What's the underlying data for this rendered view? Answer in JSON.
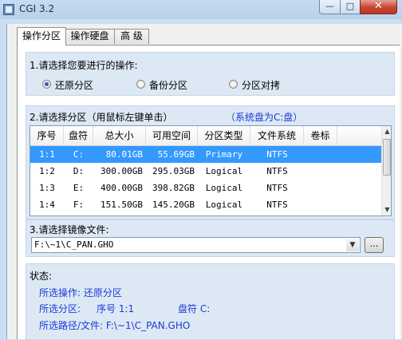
{
  "window": {
    "title": "CGI 3.2"
  },
  "tabs": [
    "操作分区",
    "操作硬盘",
    "高 级"
  ],
  "operation": {
    "label": "1.请选择您要进行的操作:",
    "options": [
      "还原分区",
      "备份分区",
      "分区对拷"
    ],
    "selected": "还原分区"
  },
  "partitions": {
    "label": "2.请选择分区（用鼠标左键单击）",
    "system_note": "（系统盘为C:盘）",
    "columns": [
      "序号",
      "盘符",
      "总大小",
      "可用空间",
      "分区类型",
      "文件系统",
      "卷标"
    ],
    "rows": [
      [
        "1:1",
        "C:",
        "80.01GB",
        "55.69GB",
        "Primary",
        "NTFS",
        ""
      ],
      [
        "1:2",
        "D:",
        "300.00GB",
        "295.03GB",
        "Logical",
        "NTFS",
        ""
      ],
      [
        "1:3",
        "E:",
        "400.00GB",
        "398.82GB",
        "Logical",
        "NTFS",
        ""
      ],
      [
        "1:4",
        "F:",
        "151.50GB",
        "145.20GB",
        "Logical",
        "NTFS",
        ""
      ]
    ],
    "selected_row": 0
  },
  "image_file": {
    "label": "3.请选择镜像文件:",
    "value": "F:\\~1\\C_PAN.GHO",
    "browse_label": "..."
  },
  "status": {
    "label": "状态:",
    "op_line": "所选操作: 还原分区",
    "part_prefix": "所选分区:",
    "part_seq": "序号 1:1",
    "part_drive": "盘符 C:",
    "path_line": "所选路径/文件: F:\\~1\\C_PAN.GHO"
  },
  "colors": {
    "accent": "#3399ff",
    "status_text": "#1a3bd6",
    "note": "#1a3bd6"
  }
}
